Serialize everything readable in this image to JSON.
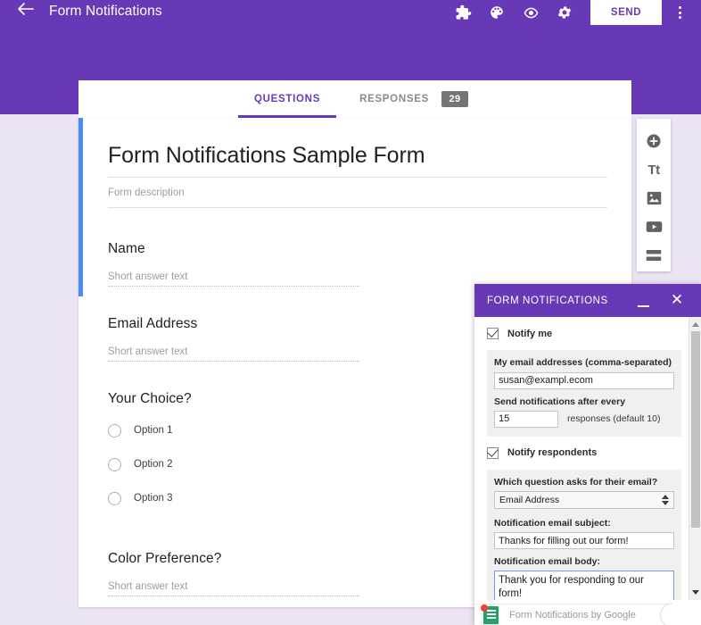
{
  "topbar": {
    "back_icon": "back-arrow-icon",
    "title": "Form Notifications",
    "icons": [
      {
        "name": "add-ons-puzzle-icon",
        "glyph": "puzzle"
      },
      {
        "name": "theme-palette-icon",
        "glyph": "palette"
      },
      {
        "name": "preview-eye-icon",
        "glyph": "eye"
      },
      {
        "name": "settings-gear-icon",
        "glyph": "gear"
      }
    ],
    "send_label": "SEND",
    "more_icon": "more-vertical-icon"
  },
  "tabs": {
    "questions_label": "QUESTIONS",
    "responses_label": "RESPONSES",
    "responses_count": "29"
  },
  "form": {
    "title": "Form Notifications Sample Form",
    "description_placeholder": "Form description",
    "accent_color": "#4c8bf5",
    "questions": [
      {
        "title": "Name",
        "type": "short-answer",
        "placeholder": "Short answer text"
      },
      {
        "title": "Email Address",
        "type": "short-answer",
        "placeholder": "Short answer text"
      },
      {
        "title": "Your Choice?",
        "type": "multiple-choice",
        "options": [
          "Option 1",
          "Option 2",
          "Option 3"
        ]
      },
      {
        "title": "Color Preference?",
        "type": "short-answer",
        "placeholder": "Short answer text"
      }
    ]
  },
  "sidetools": [
    {
      "name": "add-question-icon",
      "glyph": "plus-circle"
    },
    {
      "name": "add-title-icon",
      "glyph": "Tt"
    },
    {
      "name": "add-image-icon",
      "glyph": "image"
    },
    {
      "name": "add-video-icon",
      "glyph": "video"
    },
    {
      "name": "add-section-icon",
      "glyph": "section"
    }
  ],
  "dialog": {
    "title": "FORM NOTIFICATIONS",
    "minimize_icon": "minimize-icon",
    "close_icon": "close-icon",
    "notify_me": {
      "label": "Notify me",
      "checked": true
    },
    "email_field": {
      "label": "My email addresses (comma-separated)",
      "value": "susan@exampl.ecom"
    },
    "frequency_field": {
      "label": "Send notifications after every",
      "value": "15",
      "suffix": "responses (default 10)"
    },
    "notify_respondents": {
      "label": "Notify respondents",
      "checked": true
    },
    "email_question": {
      "label": "Which question asks for their email?",
      "selected": "Email Address"
    },
    "subject_field": {
      "label": "Notification email subject:",
      "value": "Thanks for filling out our form!"
    },
    "body_field": {
      "label": "Notification email body:",
      "value": "Thank you for responding to our form!"
    }
  },
  "statusbar": {
    "icon": "google-sheets-icon",
    "text": "Form Notifications by Google"
  },
  "colors": {
    "purple": "#6739b7",
    "page_background": "#ece4f4",
    "accent_blue": "#4c8bf5",
    "badge_gray": "#757575"
  }
}
